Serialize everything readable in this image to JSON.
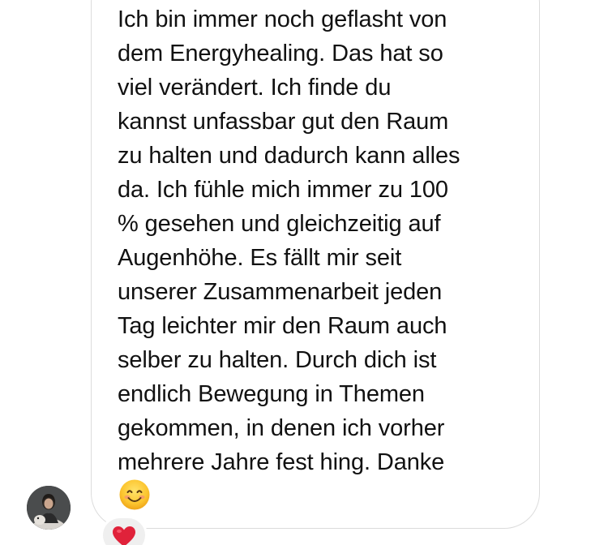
{
  "message": {
    "lines": [
      "Ich bin immer noch geflasht von",
      "dem Energyhealing. Das hat so",
      "viel verändert. Ich finde du",
      "kannst unfassbar gut den Raum",
      "zu halten und dadurch kann alles",
      "da. Ich fühle mich immer zu 100",
      "% gesehen und gleichzeitig auf",
      "Augenhöhe. Es fällt mir seit",
      "unserer Zusammenarbeit jeden",
      "Tag leichter mir den Raum auch",
      "selber zu halten. Durch dich ist",
      "endlich Bewegung in Themen",
      "gekommen, in denen ich vorher",
      "mehrere Jahre fest hing. Danke"
    ],
    "emoji": "smiling-face-with-smiling-eyes-emoji"
  },
  "sender": {
    "avatar": "profile-photo"
  },
  "reaction": {
    "icon": "red-heart-icon",
    "color": "#e0223a"
  },
  "colors": {
    "bubble_border": "#dcdcdc",
    "text": "#111111",
    "reaction_bg": "#efefef"
  }
}
